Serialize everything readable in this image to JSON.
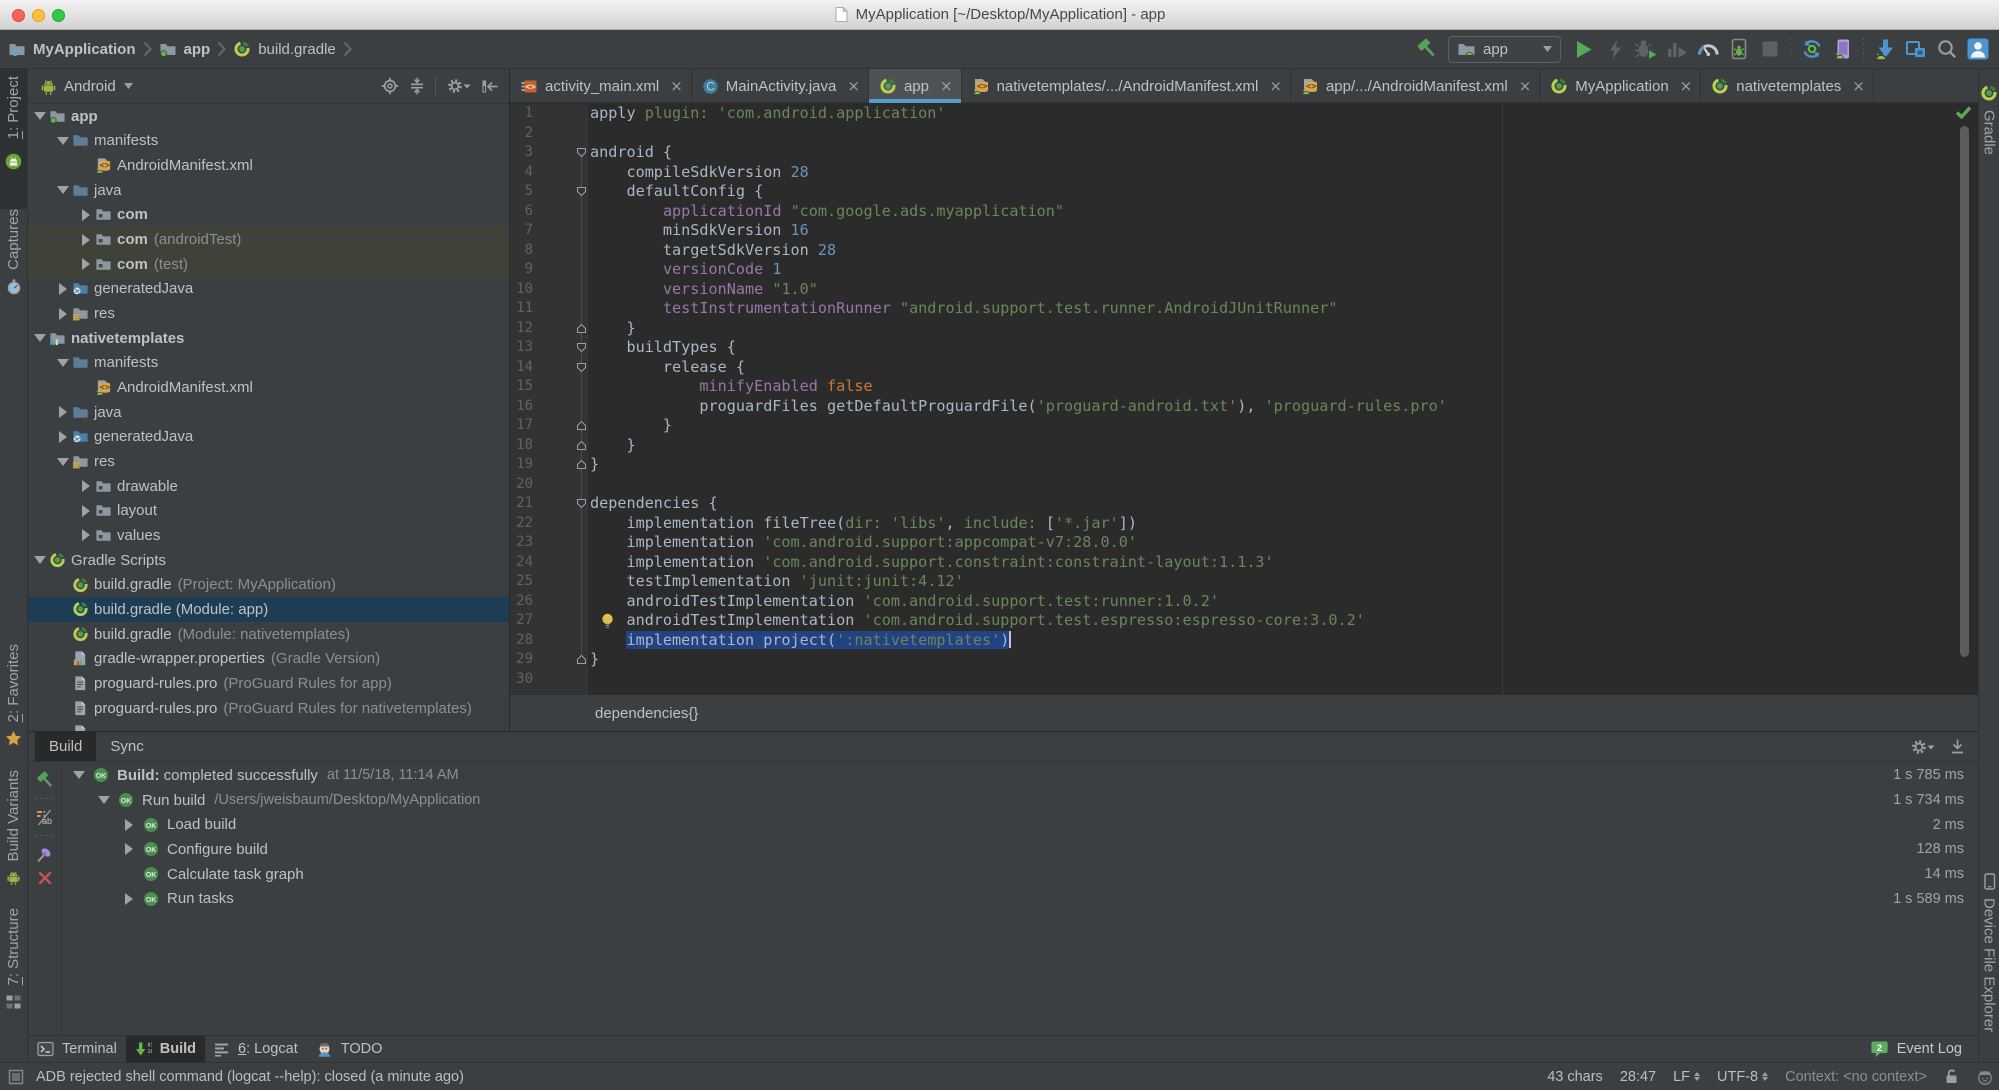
{
  "window": {
    "title": "MyApplication [~/Desktop/MyApplication] - app"
  },
  "navbar": {
    "breadcrumbs": [
      {
        "label": "MyApplication",
        "icon": "project-folder-icon",
        "bold": true
      },
      {
        "label": "app",
        "icon": "module-folder-icon",
        "bold": true
      },
      {
        "label": "build.gradle",
        "icon": "gradle-icon",
        "bold": false
      }
    ],
    "run_config": "app"
  },
  "left_stripe": {
    "top": [
      {
        "label": "1: Project",
        "pre": "1",
        "rest": ": Project",
        "icon": "project-view-icon",
        "active": true
      },
      {
        "label": "Captures",
        "pre": "",
        "rest": "Captures",
        "icon": "captures-icon",
        "active": false
      }
    ],
    "bottom": [
      {
        "label": "2: Favorites",
        "pre": "2",
        "rest": ": Favorites",
        "icon": "star-icon",
        "active": false
      },
      {
        "label": "Build Variants",
        "pre": "",
        "rest": "Build Variants",
        "icon": "android-icon",
        "active": false
      },
      {
        "label": "7: Structure",
        "pre": "7",
        "rest": ": Structure",
        "icon": "structure-icon",
        "active": false
      }
    ]
  },
  "right_stripe": {
    "top": [
      {
        "label": "Gradle",
        "icon": "gradle-icon"
      }
    ],
    "bottom": [
      {
        "label": "Device File Explorer",
        "icon": "device-icon"
      }
    ]
  },
  "project_panel": {
    "view_selector": "Android",
    "tree": [
      {
        "depth": 0,
        "arrow": "down",
        "icon": "module-folder",
        "label": "app",
        "bold": true
      },
      {
        "depth": 1,
        "arrow": "down",
        "icon": "folder",
        "label": "manifests"
      },
      {
        "depth": 2,
        "arrow": "none",
        "icon": "manifest-file",
        "label": "AndroidManifest.xml"
      },
      {
        "depth": 1,
        "arrow": "down",
        "icon": "folder",
        "label": "java"
      },
      {
        "depth": 2,
        "arrow": "right",
        "icon": "package",
        "label": "com",
        "bold": true
      },
      {
        "depth": 2,
        "arrow": "right",
        "icon": "package",
        "label": "com",
        "bold": true,
        "suffix": "(androidTest)",
        "highlight": true
      },
      {
        "depth": 2,
        "arrow": "right",
        "icon": "package",
        "label": "com",
        "bold": true,
        "suffix": "(test)",
        "highlight": true
      },
      {
        "depth": 1,
        "arrow": "right",
        "icon": "generated-folder",
        "label": "generatedJava"
      },
      {
        "depth": 1,
        "arrow": "right",
        "icon": "res-folder",
        "label": "res"
      },
      {
        "depth": 0,
        "arrow": "down",
        "icon": "library-module",
        "label": "nativetemplates",
        "bold": true
      },
      {
        "depth": 1,
        "arrow": "down",
        "icon": "folder",
        "label": "manifests"
      },
      {
        "depth": 2,
        "arrow": "none",
        "icon": "manifest-file",
        "label": "AndroidManifest.xml"
      },
      {
        "depth": 1,
        "arrow": "right",
        "icon": "folder",
        "label": "java"
      },
      {
        "depth": 1,
        "arrow": "right",
        "icon": "generated-folder",
        "label": "generatedJava"
      },
      {
        "depth": 1,
        "arrow": "down",
        "icon": "res-folder",
        "label": "res"
      },
      {
        "depth": 2,
        "arrow": "right",
        "icon": "package",
        "label": "drawable"
      },
      {
        "depth": 2,
        "arrow": "right",
        "icon": "package",
        "label": "layout"
      },
      {
        "depth": 2,
        "arrow": "right",
        "icon": "package",
        "label": "values"
      },
      {
        "depth": 0,
        "arrow": "down",
        "icon": "gradle",
        "label": "Gradle Scripts"
      },
      {
        "depth": 1,
        "arrow": "none",
        "icon": "gradle",
        "label": "build.gradle",
        "suffix": "(Project: MyApplication)"
      },
      {
        "depth": 1,
        "arrow": "none",
        "icon": "gradle",
        "label": "build.gradle (Module: app)",
        "selected": true
      },
      {
        "depth": 1,
        "arrow": "none",
        "icon": "gradle",
        "label": "build.gradle",
        "suffix": "(Module: nativetemplates)"
      },
      {
        "depth": 1,
        "arrow": "none",
        "icon": "wrapper-file",
        "label": "gradle-wrapper.properties",
        "suffix": "(Gradle Version)"
      },
      {
        "depth": 1,
        "arrow": "none",
        "icon": "text-file",
        "label": "proguard-rules.pro",
        "suffix": "(ProGuard Rules for app)"
      },
      {
        "depth": 1,
        "arrow": "none",
        "icon": "text-file",
        "label": "proguard-rules.pro",
        "suffix": "(ProGuard Rules for nativetemplates)"
      },
      {
        "depth": 1,
        "arrow": "none",
        "icon": "wrapper-file",
        "label": ""
      }
    ]
  },
  "editor": {
    "tabs": [
      {
        "label": "activity_main.xml",
        "icon": "layout-xml-file"
      },
      {
        "label": "MainActivity.java",
        "icon": "java-class"
      },
      {
        "label": "app",
        "icon": "gradle",
        "active": true
      },
      {
        "label": "nativetemplates/.../AndroidManifest.xml",
        "icon": "manifest-file"
      },
      {
        "label": "app/.../AndroidManifest.xml",
        "icon": "manifest-file"
      },
      {
        "label": "MyApplication",
        "icon": "gradle"
      },
      {
        "label": "nativetemplates",
        "icon": "gradle"
      }
    ],
    "breadcrumb": "dependencies{}",
    "code_lines": [
      {
        "n": 1,
        "segs": [
          [
            "cd",
            "apply "
          ],
          [
            "cs",
            "plugin: 'com.android.application'"
          ]
        ]
      },
      {
        "n": 2,
        "segs": []
      },
      {
        "n": 3,
        "fold": "start",
        "segs": [
          [
            "cd",
            "android {"
          ]
        ]
      },
      {
        "n": 4,
        "segs": [
          [
            "cd",
            "    compileSdkVersion "
          ],
          [
            "cn",
            "28"
          ]
        ]
      },
      {
        "n": 5,
        "fold": "start",
        "segs": [
          [
            "cd",
            "    defaultConfig {"
          ]
        ]
      },
      {
        "n": 6,
        "segs": [
          [
            "cd",
            "        "
          ],
          [
            "cp",
            "applicationId "
          ],
          [
            "cs",
            "\"com.google.ads.myapplication\""
          ]
        ]
      },
      {
        "n": 7,
        "segs": [
          [
            "cd",
            "        minSdkVersion "
          ],
          [
            "cn",
            "16"
          ]
        ]
      },
      {
        "n": 8,
        "segs": [
          [
            "cd",
            "        targetSdkVersion "
          ],
          [
            "cn",
            "28"
          ]
        ]
      },
      {
        "n": 9,
        "segs": [
          [
            "cd",
            "        "
          ],
          [
            "cp",
            "versionCode "
          ],
          [
            "cn",
            "1"
          ]
        ]
      },
      {
        "n": 10,
        "segs": [
          [
            "cd",
            "        "
          ],
          [
            "cp",
            "versionName "
          ],
          [
            "cs",
            "\"1.0\""
          ]
        ]
      },
      {
        "n": 11,
        "segs": [
          [
            "cd",
            "        "
          ],
          [
            "cp",
            "testInstrumentationRunner "
          ],
          [
            "cs",
            "\"android.support.test.runner.AndroidJUnitRunner\""
          ]
        ]
      },
      {
        "n": 12,
        "fold": "end",
        "segs": [
          [
            "cd",
            "    }"
          ]
        ]
      },
      {
        "n": 13,
        "fold": "start",
        "segs": [
          [
            "cd",
            "    buildTypes {"
          ]
        ]
      },
      {
        "n": 14,
        "fold": "start",
        "segs": [
          [
            "cd",
            "        release {"
          ]
        ]
      },
      {
        "n": 15,
        "segs": [
          [
            "cd",
            "            "
          ],
          [
            "cp",
            "minifyEnabled "
          ],
          [
            "ck",
            "false"
          ]
        ]
      },
      {
        "n": 16,
        "segs": [
          [
            "cd",
            "            proguardFiles getDefaultProguardFile("
          ],
          [
            "cs",
            "'proguard-android.txt'"
          ],
          [
            "cd",
            "), "
          ],
          [
            "cs",
            "'proguard-rules.pro'"
          ]
        ]
      },
      {
        "n": 17,
        "fold": "end",
        "segs": [
          [
            "cd",
            "        }"
          ]
        ]
      },
      {
        "n": 18,
        "fold": "end",
        "segs": [
          [
            "cd",
            "    }"
          ]
        ]
      },
      {
        "n": 19,
        "fold": "end",
        "segs": [
          [
            "cd",
            "}"
          ]
        ]
      },
      {
        "n": 20,
        "segs": []
      },
      {
        "n": 21,
        "fold": "start",
        "segs": [
          [
            "cd",
            "dependencies {"
          ]
        ]
      },
      {
        "n": 22,
        "segs": [
          [
            "cd",
            "    implementation fileTree("
          ],
          [
            "cs",
            "dir: 'libs'"
          ],
          [
            "cd",
            ", "
          ],
          [
            "cs",
            "include: "
          ],
          [
            "cd",
            "["
          ],
          [
            "cs",
            "'*.jar'"
          ],
          [
            "cd",
            "])"
          ]
        ]
      },
      {
        "n": 23,
        "segs": [
          [
            "cd",
            "    implementation "
          ],
          [
            "cs",
            "'com.android.support:appcompat-v7:28.0.0'"
          ]
        ]
      },
      {
        "n": 24,
        "segs": [
          [
            "cd",
            "    implementation "
          ],
          [
            "cs",
            "'com.android.support.constraint:constraint-layout:1.1.3'"
          ]
        ]
      },
      {
        "n": 25,
        "segs": [
          [
            "cd",
            "    testImplementation "
          ],
          [
            "cs",
            "'junit:junit:4.12'"
          ]
        ]
      },
      {
        "n": 26,
        "segs": [
          [
            "cd",
            "    androidTestImplementation "
          ],
          [
            "cs",
            "'com.android.support.test:runner:1.0.2'"
          ]
        ]
      },
      {
        "n": 27,
        "bulb": true,
        "segs": [
          [
            "cd",
            "    androidTestImplementation "
          ],
          [
            "cs",
            "'com.android.support.test.espresso:espresso-core:3.0.2'"
          ]
        ]
      },
      {
        "n": 28,
        "caret": true,
        "segs": [
          [
            "cd",
            "    "
          ],
          [
            "cd sel",
            "implementation project("
          ],
          [
            "cs sel",
            "':nativetemplates'"
          ],
          [
            "cd sel",
            ")"
          ]
        ]
      },
      {
        "n": 29,
        "fold": "end",
        "segs": [
          [
            "cd",
            "}"
          ]
        ]
      },
      {
        "n": 30,
        "segs": []
      }
    ]
  },
  "build_panel": {
    "tabs": [
      {
        "label": "Build",
        "active": true
      },
      {
        "label": "Sync",
        "active": false
      }
    ],
    "rows": [
      {
        "indent": 0,
        "arrow": "down",
        "icon": "ok",
        "title": "Build:",
        "bold": true,
        "text": " completed successfully",
        "gray": "at 11/5/18, 11:14 AM",
        "duration": "1 s 785 ms"
      },
      {
        "indent": 1,
        "arrow": "down",
        "icon": "ok",
        "title": "Run build",
        "text": "",
        "gray": "/Users/jweisbaum/Desktop/MyApplication",
        "duration": "1 s 734 ms"
      },
      {
        "indent": 2,
        "arrow": "right",
        "icon": "ok",
        "title": "Load build",
        "duration": "2 ms"
      },
      {
        "indent": 2,
        "arrow": "right",
        "icon": "ok",
        "title": "Configure build",
        "duration": "128 ms"
      },
      {
        "indent": 2,
        "arrow": "none",
        "icon": "ok",
        "title": "Calculate task graph",
        "duration": "14 ms"
      },
      {
        "indent": 2,
        "arrow": "right",
        "icon": "ok",
        "title": "Run tasks",
        "duration": "1 s 589 ms"
      }
    ]
  },
  "bottom_bar": {
    "tabs": [
      {
        "label": "Terminal",
        "pre": "",
        "rest": "Terminal",
        "icon": "terminal-icon"
      },
      {
        "label": "Build",
        "pre": "",
        "rest": "Build",
        "icon": "build-icon",
        "active": true
      },
      {
        "label": "6: Logcat",
        "pre": "6",
        "rest": ": Logcat",
        "icon": "logcat-icon"
      },
      {
        "label": "TODO",
        "pre": "",
        "rest": "TODO",
        "icon": "todo-icon"
      }
    ],
    "event_log": {
      "label": "Event Log",
      "badge": "2"
    }
  },
  "status_bar": {
    "message": "ADB rejected shell command (logcat --help): closed (a minute ago)",
    "char_count": "43 chars",
    "caret_position": "28:47",
    "line_separator": "LF",
    "encoding": "UTF-8",
    "context": "Context: <no context>"
  },
  "colors": {
    "panel_bg": "#3c3f41",
    "editor_bg": "#2b2b2b",
    "tree_selection": "#1d3d54",
    "test_scope_highlight": "#3e4238",
    "editor_selection": "#214283",
    "active_tab_underline": "#4f9ddc",
    "string": "#6a8759",
    "number": "#6897bb",
    "keyword": "#cc7832",
    "property": "#9876aa",
    "default_text": "#a9b7c6"
  }
}
